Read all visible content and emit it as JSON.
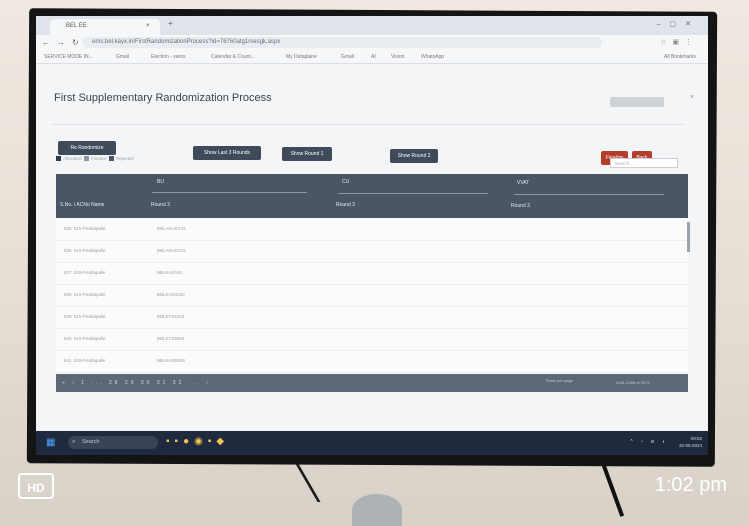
{
  "browser": {
    "tab_title": "BEL EE",
    "url": "ems.bel.kayx.in/FirstRandomizationProcess?id=76760atg1rsesgk.aspx",
    "bookmarks": [
      "SERVICE MODE IN...",
      "Gmail",
      "Election - swiss",
      "Calendar & Count...",
      "My Dataplane",
      "Gmail",
      "AI",
      "Vision",
      "WhatsApp"
    ],
    "all_bookmarks": "All Bookmarks"
  },
  "page": {
    "title": "First Supplementary Randomization Process",
    "buttons": {
      "re_randomize": "Re Randomize",
      "show_last_3": "Show Last 3 Rounds",
      "show_round_1": "Show Round 1",
      "show_round_2": "Show Round 2",
      "finalize": "Finalize",
      "back": "Back"
    },
    "legend": [
      "Allocated",
      "Finalize",
      "Rejected"
    ],
    "search_placeholder": "Search..."
  },
  "table": {
    "group_headers": [
      "BU",
      "CU",
      "VVAT"
    ],
    "left_header": "S.No. / ACNo Name",
    "sub_headers": [
      "Round 3",
      "Round 3",
      "Round 3"
    ],
    "rows": [
      {
        "sno": "835",
        "ac": "515-Peddapalle",
        "bu": "BBLAKHST43"
      },
      {
        "sno": "836",
        "ac": "515-Peddapalle",
        "bu": "BBLAKHST23"
      },
      {
        "sno": "837",
        "ac": "515-Peddapalle",
        "bu": "BBLKHSX61"
      },
      {
        "sno": "838",
        "ac": "515-Peddapalle",
        "bu": "BBLKHS1023"
      },
      {
        "sno": "839",
        "ac": "515-Peddapalle",
        "bu": "BBLKTS6423"
      },
      {
        "sno": "840",
        "ac": "515-Peddapalle",
        "bu": "BBLKTS9602"
      },
      {
        "sno": "841",
        "ac": "515-Peddapalle",
        "bu": "BBLKHS5828"
      }
    ],
    "pagination": [
      "«",
      "‹",
      "1",
      "...",
      "28",
      "29",
      "30",
      "31",
      "32",
      "...",
      "›"
    ],
    "rows_per_page": "Rows per page",
    "range": "2261-2280 of 2372"
  },
  "taskbar": {
    "search": "Search",
    "time": "09:02",
    "date": "20-05-2024"
  },
  "overlay": {
    "hd": "HD",
    "clock": "1:02 pm"
  }
}
